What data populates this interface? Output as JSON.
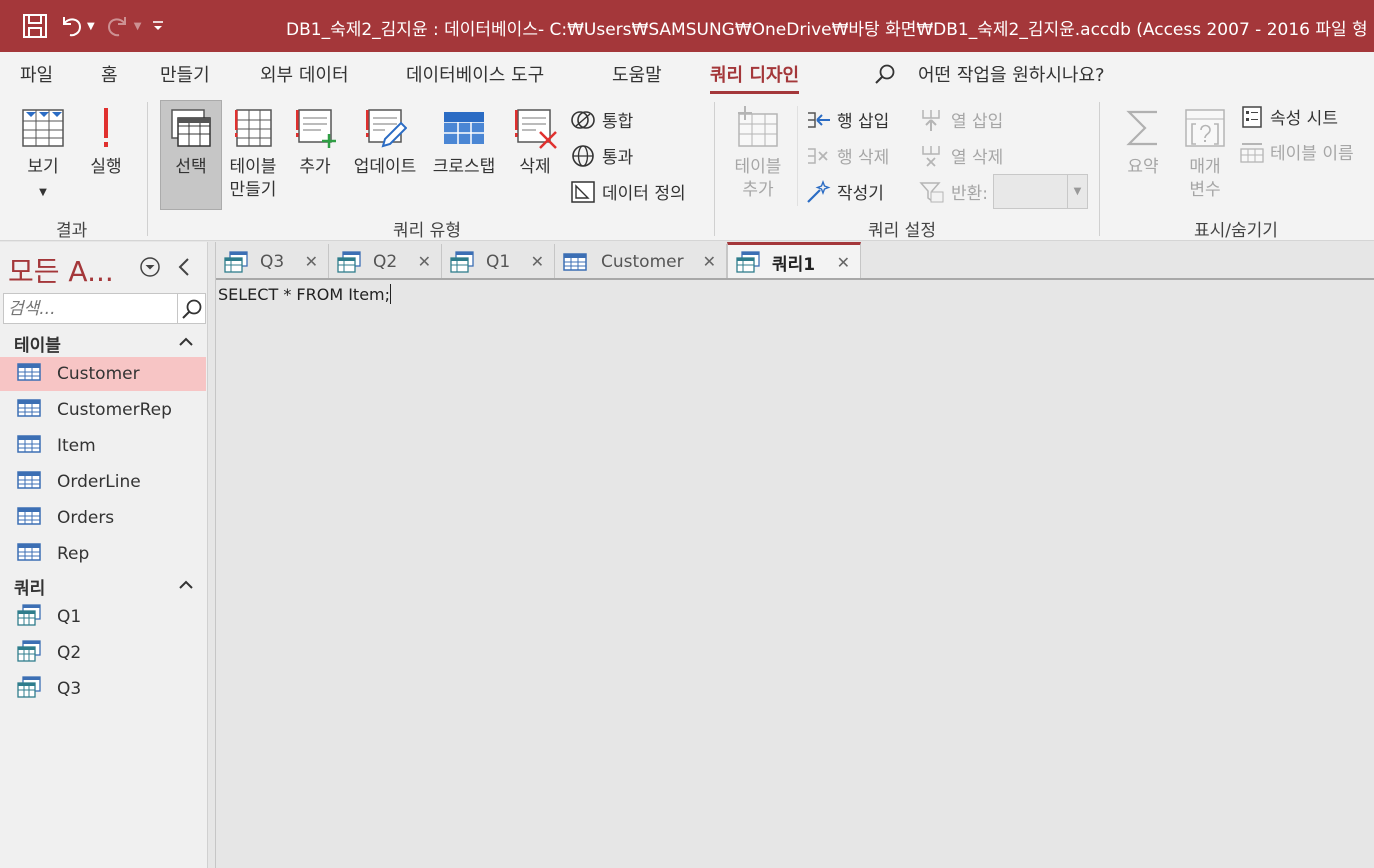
{
  "window": {
    "title": "DB1_숙제2_김지윤 : 데이터베이스- C:₩Users₩SAMSUNG₩OneDrive₩바탕 화면₩DB1_숙제2_김지윤.accdb (Access 2007 - 2016 파일 형"
  },
  "menu": {
    "tabs": [
      "파일",
      "홈",
      "만들기",
      "외부 데이터",
      "데이터베이스 도구",
      "도움말",
      "쿼리 디자인"
    ],
    "active": "쿼리 디자인",
    "tell_me": "어떤 작업을 원하시나요?"
  },
  "ribbon": {
    "results": {
      "view": "보기",
      "run": "실행",
      "label": "결과"
    },
    "query_type": {
      "select": "선택",
      "make_table_1": "테이블",
      "make_table_2": "만들기",
      "append": "추가",
      "update": "업데이트",
      "crosstab": "크로스탭",
      "delete": "삭제",
      "union": "통합",
      "passthrough": "통과",
      "data_definition": "데이터 정의",
      "label": "쿼리 유형"
    },
    "query_setup": {
      "add_table_1": "테이블",
      "add_table_2": "추가",
      "insert_rows": "행 삽입",
      "delete_rows": "행 삭제",
      "builder": "작성기",
      "insert_cols": "열 삽입",
      "delete_cols": "열 삭제",
      "return": "반환:",
      "label": "쿼리 설정"
    },
    "show_hide": {
      "totals": "요약",
      "params_1": "매개",
      "params_2": "변수",
      "property_sheet": "속성 시트",
      "table_names": "테이블 이름",
      "label": "표시/숨기기"
    }
  },
  "nav": {
    "title": "모든 A...",
    "search_placeholder": "검색...",
    "tables_header": "테이블",
    "tables": [
      "Customer",
      "CustomerRep",
      "Item",
      "OrderLine",
      "Orders",
      "Rep"
    ],
    "queries_header": "쿼리",
    "queries": [
      "Q1",
      "Q2",
      "Q3"
    ],
    "selected": "Customer"
  },
  "documents": {
    "tabs": [
      "Q3",
      "Q2",
      "Q1",
      "Customer",
      "쿼리1"
    ],
    "active": "쿼리1",
    "sql": "SELECT * FROM Item;"
  },
  "colors": {
    "accent": "#a4373a",
    "selected_bg": "#f7c5c5",
    "table_icon": "#3c6fb4"
  }
}
